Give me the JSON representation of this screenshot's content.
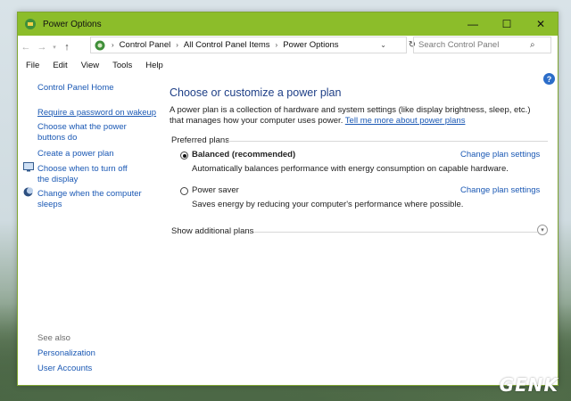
{
  "window": {
    "title": "Power Options",
    "accent_color": "#8cbd2a",
    "controls": {
      "minimize": "—",
      "maximize": "☐",
      "close": "✕"
    }
  },
  "address": {
    "breadcrumbs": [
      "Control Panel",
      "All Control Panel Items",
      "Power Options"
    ],
    "search_placeholder": "Search Control Panel"
  },
  "menu": [
    "File",
    "Edit",
    "View",
    "Tools",
    "Help"
  ],
  "sidebar": {
    "home": "Control Panel Home",
    "items": [
      {
        "label": "Require a password on wakeup",
        "icon": null
      },
      {
        "label": "Choose what the power buttons do",
        "icon": null
      },
      {
        "label": "Create a power plan",
        "icon": null
      },
      {
        "label": "Choose when to turn off the display",
        "icon": "monitor-icon"
      },
      {
        "label": "Change when the computer sleeps",
        "icon": "moon-icon"
      }
    ],
    "see_also_label": "See also",
    "see_also": [
      "Personalization",
      "User Accounts"
    ]
  },
  "main": {
    "heading": "Choose or customize a power plan",
    "intro": "A power plan is a collection of hardware and system settings (like display brightness, sleep, etc.) that manages how your computer uses power.",
    "intro_link": "Tell me more about power plans",
    "preferred_plans_label": "Preferred plans",
    "plans": [
      {
        "name": "Balanced (recommended)",
        "selected": true,
        "description": "Automatically balances performance with energy consumption on capable hardware.",
        "link": "Change plan settings"
      },
      {
        "name": "Power saver",
        "selected": false,
        "description": "Saves energy by reducing your computer's performance where possible.",
        "link": "Change plan settings"
      }
    ],
    "additional_plans_label": "Show additional plans"
  },
  "watermark": "GENK"
}
